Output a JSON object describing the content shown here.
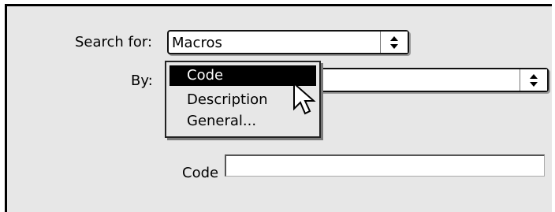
{
  "search_for": {
    "label": "Search for:",
    "selected_value": "Macros"
  },
  "by": {
    "label": "By:",
    "menu_items": [
      {
        "label": "Code",
        "selected": true
      },
      {
        "label": "Description",
        "selected": false
      },
      {
        "label": "General...",
        "selected": false
      }
    ]
  },
  "code_field": {
    "label": "Code",
    "value": ""
  },
  "icons": {
    "popup_arrows": "up-down-arrows-icon",
    "cursor": "mouse-pointer-icon"
  },
  "colors": {
    "panel_background": "#e7e7e7",
    "selected_item_background": "#000000",
    "selected_item_text": "#ffffff"
  }
}
